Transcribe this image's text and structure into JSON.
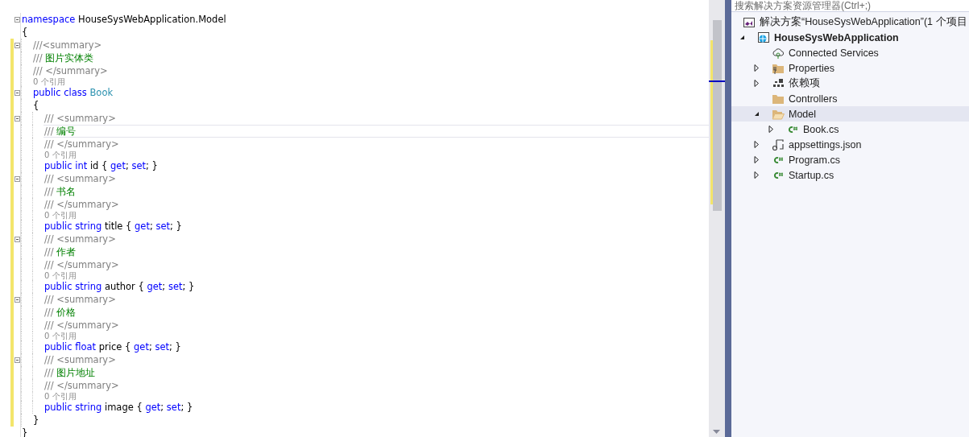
{
  "editor": {
    "lines": [
      {
        "kind": "code",
        "foldable": true,
        "changed": false,
        "current": false,
        "tokens": [
          {
            "kind": "kw",
            "s": "namespace"
          },
          {
            "kind": "plain",
            "s": " HouseSysWebApplication.Model"
          }
        ]
      },
      {
        "kind": "code",
        "foldable": false,
        "changed": false,
        "current": false,
        "tokens": [
          {
            "kind": "plain",
            "s": "{"
          }
        ]
      },
      {
        "kind": "group",
        "children": [
          {
            "kind": "code",
            "foldable": true,
            "changed": true,
            "current": false,
            "tokens": [
              {
                "kind": "doc",
                "s": "///<summary>"
              }
            ]
          },
          {
            "kind": "code",
            "foldable": false,
            "changed": true,
            "current": false,
            "tokens": [
              {
                "kind": "doc",
                "s": "/// "
              },
              {
                "kind": "comment",
                "s": "图片实体类"
              }
            ]
          },
          {
            "kind": "code",
            "foldable": false,
            "changed": true,
            "current": false,
            "tokens": [
              {
                "kind": "doc",
                "s": "/// </summary>"
              }
            ]
          },
          {
            "kind": "lens",
            "changed": true,
            "text": "0 个引用"
          },
          {
            "kind": "code",
            "foldable": true,
            "changed": true,
            "current": false,
            "tokens": [
              {
                "kind": "kw",
                "s": "public class "
              },
              {
                "kind": "type",
                "s": "Book"
              }
            ]
          },
          {
            "kind": "code",
            "foldable": false,
            "changed": true,
            "current": false,
            "tokens": [
              {
                "kind": "plain",
                "s": "{"
              }
            ]
          },
          {
            "kind": "group",
            "children": [
              {
                "kind": "code",
                "foldable": true,
                "changed": true,
                "current": false,
                "tokens": [
                  {
                    "kind": "doc",
                    "s": "/// <summary>"
                  }
                ]
              },
              {
                "kind": "code",
                "foldable": false,
                "changed": true,
                "current": true,
                "tokens": [
                  {
                    "kind": "doc",
                    "s": "/// "
                  },
                  {
                    "kind": "comment",
                    "s": "编号"
                  }
                ]
              },
              {
                "kind": "code",
                "foldable": false,
                "changed": true,
                "current": false,
                "tokens": [
                  {
                    "kind": "doc",
                    "s": "/// </summary>"
                  }
                ]
              },
              {
                "kind": "lens",
                "changed": true,
                "text": "0 个引用"
              },
              {
                "kind": "code",
                "foldable": false,
                "changed": true,
                "current": false,
                "tokens": [
                  {
                    "kind": "kw",
                    "s": "public int "
                  },
                  {
                    "kind": "plain",
                    "s": "id { "
                  },
                  {
                    "kind": "kw",
                    "s": "get"
                  },
                  {
                    "kind": "plain",
                    "s": "; "
                  },
                  {
                    "kind": "kw",
                    "s": "set"
                  },
                  {
                    "kind": "plain",
                    "s": "; }"
                  }
                ]
              },
              {
                "kind": "code",
                "foldable": true,
                "changed": true,
                "current": false,
                "tokens": [
                  {
                    "kind": "doc",
                    "s": "/// <summary>"
                  }
                ]
              },
              {
                "kind": "code",
                "foldable": false,
                "changed": true,
                "current": false,
                "tokens": [
                  {
                    "kind": "doc",
                    "s": "/// "
                  },
                  {
                    "kind": "comment",
                    "s": "书名"
                  }
                ]
              },
              {
                "kind": "code",
                "foldable": false,
                "changed": true,
                "current": false,
                "tokens": [
                  {
                    "kind": "doc",
                    "s": "/// </summary>"
                  }
                ]
              },
              {
                "kind": "lens",
                "changed": true,
                "text": "0 个引用"
              },
              {
                "kind": "code",
                "foldable": false,
                "changed": true,
                "current": false,
                "tokens": [
                  {
                    "kind": "kw",
                    "s": "public string "
                  },
                  {
                    "kind": "plain",
                    "s": "title { "
                  },
                  {
                    "kind": "kw",
                    "s": "get"
                  },
                  {
                    "kind": "plain",
                    "s": "; "
                  },
                  {
                    "kind": "kw",
                    "s": "set"
                  },
                  {
                    "kind": "plain",
                    "s": "; }"
                  }
                ]
              },
              {
                "kind": "code",
                "foldable": true,
                "changed": true,
                "current": false,
                "tokens": [
                  {
                    "kind": "doc",
                    "s": "/// <summary>"
                  }
                ]
              },
              {
                "kind": "code",
                "foldable": false,
                "changed": true,
                "current": false,
                "tokens": [
                  {
                    "kind": "doc",
                    "s": "/// "
                  },
                  {
                    "kind": "comment",
                    "s": "作者"
                  }
                ]
              },
              {
                "kind": "code",
                "foldable": false,
                "changed": true,
                "current": false,
                "tokens": [
                  {
                    "kind": "doc",
                    "s": "/// </summary>"
                  }
                ]
              },
              {
                "kind": "lens",
                "changed": true,
                "text": "0 个引用"
              },
              {
                "kind": "code",
                "foldable": false,
                "changed": true,
                "current": false,
                "tokens": [
                  {
                    "kind": "kw",
                    "s": "public string "
                  },
                  {
                    "kind": "plain",
                    "s": "author { "
                  },
                  {
                    "kind": "kw",
                    "s": "get"
                  },
                  {
                    "kind": "plain",
                    "s": "; "
                  },
                  {
                    "kind": "kw",
                    "s": "set"
                  },
                  {
                    "kind": "plain",
                    "s": "; }"
                  }
                ]
              },
              {
                "kind": "code",
                "foldable": true,
                "changed": true,
                "current": false,
                "tokens": [
                  {
                    "kind": "doc",
                    "s": "/// <summary>"
                  }
                ]
              },
              {
                "kind": "code",
                "foldable": false,
                "changed": true,
                "current": false,
                "tokens": [
                  {
                    "kind": "doc",
                    "s": "/// "
                  },
                  {
                    "kind": "comment",
                    "s": "价格"
                  }
                ]
              },
              {
                "kind": "code",
                "foldable": false,
                "changed": true,
                "current": false,
                "tokens": [
                  {
                    "kind": "doc",
                    "s": "/// </summary>"
                  }
                ]
              },
              {
                "kind": "lens",
                "changed": true,
                "text": "0 个引用"
              },
              {
                "kind": "code",
                "foldable": false,
                "changed": true,
                "current": false,
                "tokens": [
                  {
                    "kind": "kw",
                    "s": "public float "
                  },
                  {
                    "kind": "plain",
                    "s": "price { "
                  },
                  {
                    "kind": "kw",
                    "s": "get"
                  },
                  {
                    "kind": "plain",
                    "s": "; "
                  },
                  {
                    "kind": "kw",
                    "s": "set"
                  },
                  {
                    "kind": "plain",
                    "s": "; }"
                  }
                ]
              },
              {
                "kind": "code",
                "foldable": true,
                "changed": true,
                "current": false,
                "tokens": [
                  {
                    "kind": "doc",
                    "s": "/// <summary>"
                  }
                ]
              },
              {
                "kind": "code",
                "foldable": false,
                "changed": true,
                "current": false,
                "tokens": [
                  {
                    "kind": "doc",
                    "s": "/// "
                  },
                  {
                    "kind": "comment",
                    "s": "图片地址"
                  }
                ]
              },
              {
                "kind": "code",
                "foldable": false,
                "changed": true,
                "current": false,
                "tokens": [
                  {
                    "kind": "doc",
                    "s": "/// </summary>"
                  }
                ]
              },
              {
                "kind": "lens",
                "changed": true,
                "text": "0 个引用"
              },
              {
                "kind": "code",
                "foldable": false,
                "changed": true,
                "current": false,
                "tokens": [
                  {
                    "kind": "kw",
                    "s": "public string "
                  },
                  {
                    "kind": "plain",
                    "s": "image { "
                  },
                  {
                    "kind": "kw",
                    "s": "get"
                  },
                  {
                    "kind": "plain",
                    "s": "; "
                  },
                  {
                    "kind": "kw",
                    "s": "set"
                  },
                  {
                    "kind": "plain",
                    "s": "; }"
                  }
                ]
              }
            ]
          },
          {
            "kind": "code",
            "foldable": false,
            "changed": true,
            "current": false,
            "tokens": [
              {
                "kind": "plain",
                "s": "}"
              }
            ]
          }
        ]
      },
      {
        "kind": "code",
        "foldable": false,
        "changed": false,
        "current": false,
        "tokens": [
          {
            "kind": "plain",
            "s": "}"
          }
        ]
      }
    ]
  },
  "solution_explorer": {
    "search": {
      "placeholder": "搜索解决方案资源管理器(Ctrl+;)"
    },
    "tree": [
      {
        "label": "解决方案“HouseSysWebApplication”(1 个项目",
        "kind": "solution",
        "selected": false,
        "bold": false,
        "children": [
          {
            "label": "HouseSysWebApplication",
            "kind": "project",
            "selected": false,
            "bold": true,
            "expanded": true,
            "children": [
              {
                "label": "Connected Services",
                "kind": "cloud",
                "selected": false,
                "bold": false
              },
              {
                "label": "Properties",
                "kind": "properties",
                "selected": false,
                "bold": false,
                "expanded": false
              },
              {
                "label": "依赖项",
                "kind": "dependencies",
                "selected": false,
                "bold": false,
                "expanded": false
              },
              {
                "label": "Controllers",
                "kind": "folder",
                "selected": false,
                "bold": false
              },
              {
                "label": "Model",
                "kind": "open-folder",
                "selected": true,
                "bold": false,
                "expanded": true,
                "children": [
                  {
                    "label": "Book.cs",
                    "kind": "csharp",
                    "selected": false,
                    "bold": false,
                    "expanded": false
                  }
                ]
              },
              {
                "label": "appsettings.json",
                "kind": "json",
                "selected": false,
                "bold": false,
                "expanded": false
              },
              {
                "label": "Program.cs",
                "kind": "csharp",
                "selected": false,
                "bold": false,
                "expanded": false
              },
              {
                "label": "Startup.cs",
                "kind": "csharp",
                "selected": false,
                "bold": false,
                "expanded": false
              }
            ]
          }
        ]
      }
    ]
  }
}
